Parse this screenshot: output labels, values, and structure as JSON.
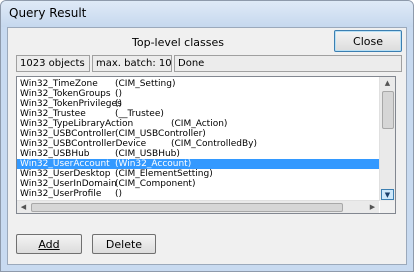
{
  "window": {
    "title": "Query Result"
  },
  "header": {
    "heading": "Top-level classes",
    "close_label": "Close"
  },
  "status": {
    "count": "1023 objects",
    "batch": "max. batch: 10",
    "state": "Done"
  },
  "rows": [
    {
      "name": "Win32_TimeZone",
      "parent": "(CIM_Setting)",
      "selected": false
    },
    {
      "name": "Win32_TokenGroups",
      "parent": "()",
      "selected": false
    },
    {
      "name": "Win32_TokenPrivileges",
      "parent": "()",
      "selected": false
    },
    {
      "name": "Win32_Trustee",
      "parent": "(__Trustee)",
      "selected": false
    },
    {
      "name": "Win32_TypeLibraryAction",
      "parent": "(CIM_Action)",
      "selected": false
    },
    {
      "name": "Win32_USBController",
      "parent": "(CIM_USBController)",
      "selected": false
    },
    {
      "name": "Win32_USBControllerDevice",
      "parent": "(CIM_ControlledBy)",
      "selected": false
    },
    {
      "name": "Win32_USBHub",
      "parent": "(CIM_USBHub)",
      "selected": false
    },
    {
      "name": "Win32_UserAccount",
      "parent": "(Win32_Account)",
      "selected": true
    },
    {
      "name": "Win32_UserDesktop",
      "parent": "(CIM_ElementSetting)",
      "selected": false
    },
    {
      "name": "Win32_UserInDomain",
      "parent": "(CIM_Component)",
      "selected": false
    },
    {
      "name": "Win32_UserProfile",
      "parent": "()",
      "selected": false
    }
  ],
  "footer": {
    "add_label": "Add",
    "delete_label": "Delete"
  },
  "icons": {
    "scroll_up": "scroll-up-arrow",
    "scroll_down": "scroll-down-arrow",
    "scroll_left": "scroll-left-arrow",
    "scroll_right": "scroll-right-arrow"
  }
}
